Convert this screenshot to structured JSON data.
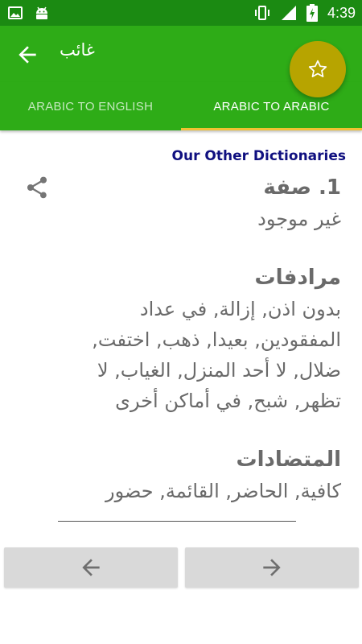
{
  "status_bar": {
    "time": "4:39",
    "icons_left": [
      "image-icon",
      "android-icon"
    ],
    "icons_right": [
      "vibrate-icon",
      "signal-icon",
      "battery-charging-icon"
    ]
  },
  "app_bar": {
    "title": "غائب",
    "back_icon": "arrow-left-icon",
    "fab_icon": "star-outline-icon"
  },
  "tabs": [
    {
      "label": "ARABIC TO ENGLISH",
      "selected": false
    },
    {
      "label": "ARABIC TO ARABIC",
      "selected": true
    }
  ],
  "other_dictionaries_link": "Our Other Dictionaries",
  "entry": {
    "heading": "1. صفة",
    "definition": "غير موجود",
    "synonyms_heading": "مرادفات",
    "synonyms": "بدون اذن, إزالة, في عداد المفقودين, بعيدا, ذهب, اختفت, ضلال, لا أحد المنزل, الغياب, لا تظهر, شبح, في أماكن أخرى",
    "antonyms_heading": "المتضادات",
    "antonyms": "كافية, الحاضر, القائمة, حضور"
  },
  "navigation": {
    "prev_icon": "arrow-left-icon",
    "next_icon": "arrow-right-icon"
  },
  "colors": {
    "status_bar": "#1b8a12",
    "primary": "#2eac17",
    "accent": "#f1c232",
    "fab": "#b7a400",
    "link": "#101080",
    "text": "#6a6a6a"
  }
}
